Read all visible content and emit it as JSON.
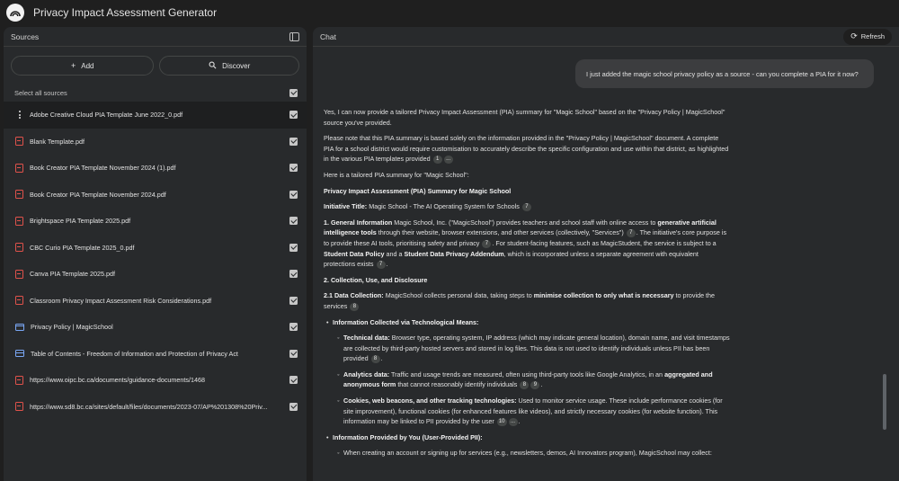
{
  "app": {
    "title": "Privacy Impact Assessment Generator"
  },
  "sources": {
    "title": "Sources",
    "add_label": "Add",
    "discover_label": "Discover",
    "select_all_label": "Select all sources",
    "items": [
      {
        "name": "Adobe Creative Cloud PIA Template June 2022_0.pdf",
        "icon": "more-vert-icon",
        "active": true
      },
      {
        "name": "Blank Template.pdf",
        "icon": "pdf-icon"
      },
      {
        "name": "Book Creator PIA Template November 2024 (1).pdf",
        "icon": "pdf-icon"
      },
      {
        "name": "Book Creator PIA Template November 2024.pdf",
        "icon": "pdf-icon"
      },
      {
        "name": "Brightspace PIA Template 2025.pdf",
        "icon": "pdf-icon"
      },
      {
        "name": "CBC Curio PIA Template 2025_0.pdf",
        "icon": "pdf-icon"
      },
      {
        "name": "Canva PIA Template 2025.pdf",
        "icon": "pdf-icon"
      },
      {
        "name": "Classroom Privacy Impact Assessment Risk Considerations.pdf",
        "icon": "pdf-icon"
      },
      {
        "name": "Privacy Policy | MagicSchool",
        "icon": "web-icon"
      },
      {
        "name": "Table of Contents - Freedom of Information and Protection of Privacy Act",
        "icon": "web-icon"
      },
      {
        "name": "https://www.oipc.bc.ca/documents/guidance-documents/1468",
        "icon": "pdf-icon"
      },
      {
        "name": "https://www.sd8.bc.ca/sites/default/files/documents/2023-07/AP%201308%20Priv...",
        "icon": "pdf-icon"
      }
    ]
  },
  "chat": {
    "title": "Chat",
    "refresh_label": "Refresh",
    "user_message": "I just added the magic school privacy policy as a source - can you complete a PIA for it now?",
    "answer": {
      "p1": "Yes, I can now provide a tailored Privacy Impact Assessment (PIA) summary for \"Magic School\" based on the \"Privacy Policy | MagicSchool\" source you've provided.",
      "p2": "Please note that this PIA summary is based solely on the information provided in the \"Privacy Policy | MagicSchool\" document. A complete PIA for a school district would require customisation to accurately describe the specific configuration and use within that district, as highlighted in the various PIA templates provided",
      "p2_cite1": "1",
      "p2_cite2": "...",
      "p3": "Here is a tailored PIA summary for \"Magic School\":",
      "h_summary": "Privacy Impact Assessment (PIA) Summary for Magic School",
      "initiative_label": "Initiative Title:",
      "initiative_text": "Magic School - The AI Operating System for Schools",
      "initiative_cite": "7",
      "gi_label": "1. General Information",
      "gi_t1": "Magic School, Inc. (\"MagicSchool\") provides teachers and school staff with online access to",
      "gi_b1": "generative artificial intelligence tools",
      "gi_t2": "through their website, browser extensions, and other services (collectively, \"Services\")",
      "gi_cite1": "7",
      "gi_t3": ". The initiative's core purpose is to provide these AI tools, prioritising safety and privacy",
      "gi_cite2": "7",
      "gi_t4": ". For student-facing features, such as MagicStudent, the service is subject to a",
      "gi_b2": "Student Data Policy",
      "gi_t5": "and a",
      "gi_b3": "Student Data Privacy Addendum",
      "gi_t6": ", which is incorporated unless a separate agreement with equivalent protections exists",
      "gi_cite3": "7",
      "h2": "2. Collection, Use, and Disclosure",
      "dc_label": "2.1 Data Collection:",
      "dc_t1": "MagicSchool collects personal data, taking steps to",
      "dc_b1": "minimise collection to only what is necessary",
      "dc_t2": "to provide the services",
      "dc_cite": "8",
      "tech_label": "Information Collected via Technological Means:",
      "td_label": "Technical data:",
      "td_text": "Browser type, operating system, IP address (which may indicate general location), domain name, and visit timestamps are collected by third-party hosted servers and stored in log files. This data is not used to identify individuals unless PII has been provided",
      "td_cite": "8",
      "ad_label": "Analytics data:",
      "ad_t1": "Traffic and usage trends are measured, often using third-party tools like Google Analytics, in an",
      "ad_b1": "aggregated and anonymous form",
      "ad_t2": "that cannot reasonably identify individuals",
      "ad_cite1": "8",
      "ad_cite2": "9",
      "ck_label": "Cookies, web beacons, and other tracking technologies:",
      "ck_text": "Used to monitor service usage. These include performance cookies (for site improvement), functional cookies (for enhanced features like videos), and strictly necessary cookies (for website function). This information may be linked to PII provided by the user",
      "ck_cite1": "10",
      "ck_cite2": "...",
      "upi_label": "Information Provided by You (User-Provided PII):",
      "upi_text": "When creating an account or signing up for services (e.g., newsletters, demos, AI Innovators program), MagicSchool may collect:"
    }
  }
}
